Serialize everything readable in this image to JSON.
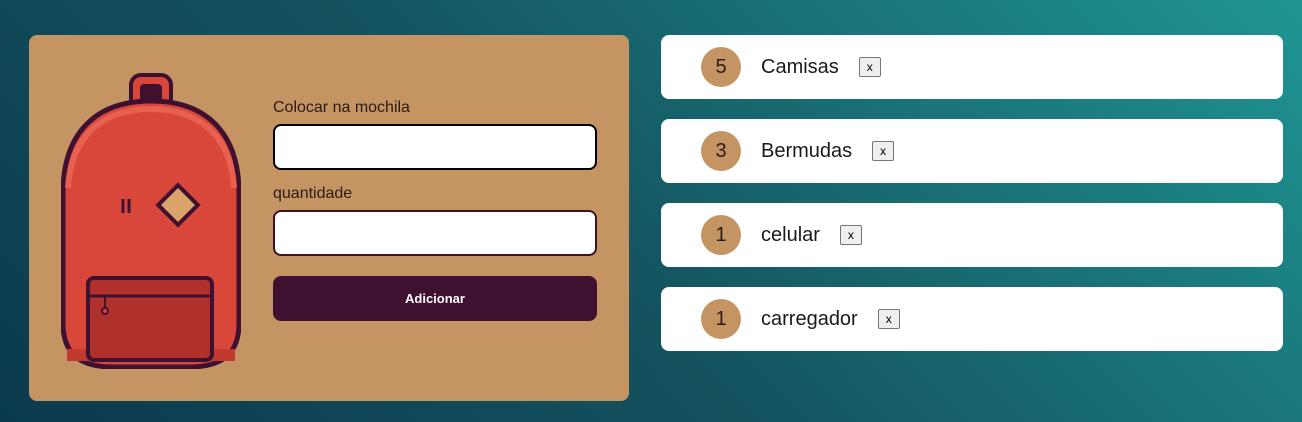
{
  "form": {
    "item_label": "Colocar na mochila",
    "item_value": "",
    "quantity_label": "quantidade",
    "quantity_value": "",
    "submit_label": "Adicionar"
  },
  "items": [
    {
      "quantity": "5",
      "name": "Camisas",
      "remove_label": "x"
    },
    {
      "quantity": "3",
      "name": "Bermudas",
      "remove_label": "x"
    },
    {
      "quantity": "1",
      "name": "celular",
      "remove_label": "x"
    },
    {
      "quantity": "1",
      "name": "carregador",
      "remove_label": "x"
    }
  ],
  "colors": {
    "panel": "#c49563",
    "button": "#401030",
    "badge": "#c49563",
    "backpack_body": "#d9473a",
    "backpack_outline": "#401030"
  }
}
